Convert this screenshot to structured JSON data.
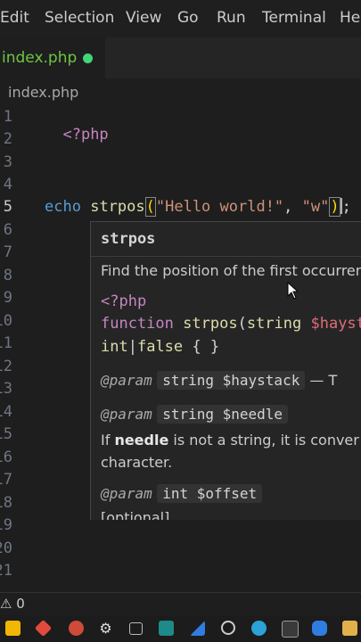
{
  "menubar": {
    "items": [
      "Edit",
      "Selection",
      "View",
      "Go",
      "Run",
      "Terminal",
      "Help"
    ]
  },
  "tab": {
    "label": "index.php"
  },
  "breadcrumb": "index.php",
  "editor": {
    "line_numbers": [
      "1",
      "2",
      "3",
      "4",
      "5",
      "6",
      "7",
      "8",
      "9",
      "10",
      "11",
      "12",
      "13",
      "14",
      "15",
      "16",
      "17",
      "18",
      "19",
      "20",
      "21"
    ],
    "active_line": "5",
    "line1": "<?php",
    "line5": {
      "echo": "echo",
      "fn": "strpos",
      "open": "(",
      "arg1": "\"Hello world!\"",
      "comma": ", ",
      "arg2": "\"w\"",
      "close": ")",
      "semi": ";"
    }
  },
  "hover": {
    "title": "strpos",
    "description": "Find the position of the first occurrence",
    "sig_open": "<?php",
    "sig_function": "function",
    "sig_name": "strpos",
    "sig_paren": "(",
    "sig_param_type": "string",
    "sig_param_var": "$hayst",
    "sig_return_int": "int",
    "sig_pipe": "|",
    "sig_return_false": "false",
    "sig_body": " { }",
    "params": [
      {
        "tag": "@param",
        "code": "string $haystack",
        "text": " — T"
      },
      {
        "tag": "@param",
        "code": "string $needle"
      },
      {
        "tag": "@param",
        "code": "int $offset"
      }
    ],
    "needle_desc_prefix": "If ",
    "needle_desc_bold": "needle",
    "needle_desc_suffix": " is not a string, it is conver",
    "needle_desc_line2": "character.",
    "offset_optional": "[optional]"
  },
  "status": {
    "text": "⚠ 0"
  }
}
